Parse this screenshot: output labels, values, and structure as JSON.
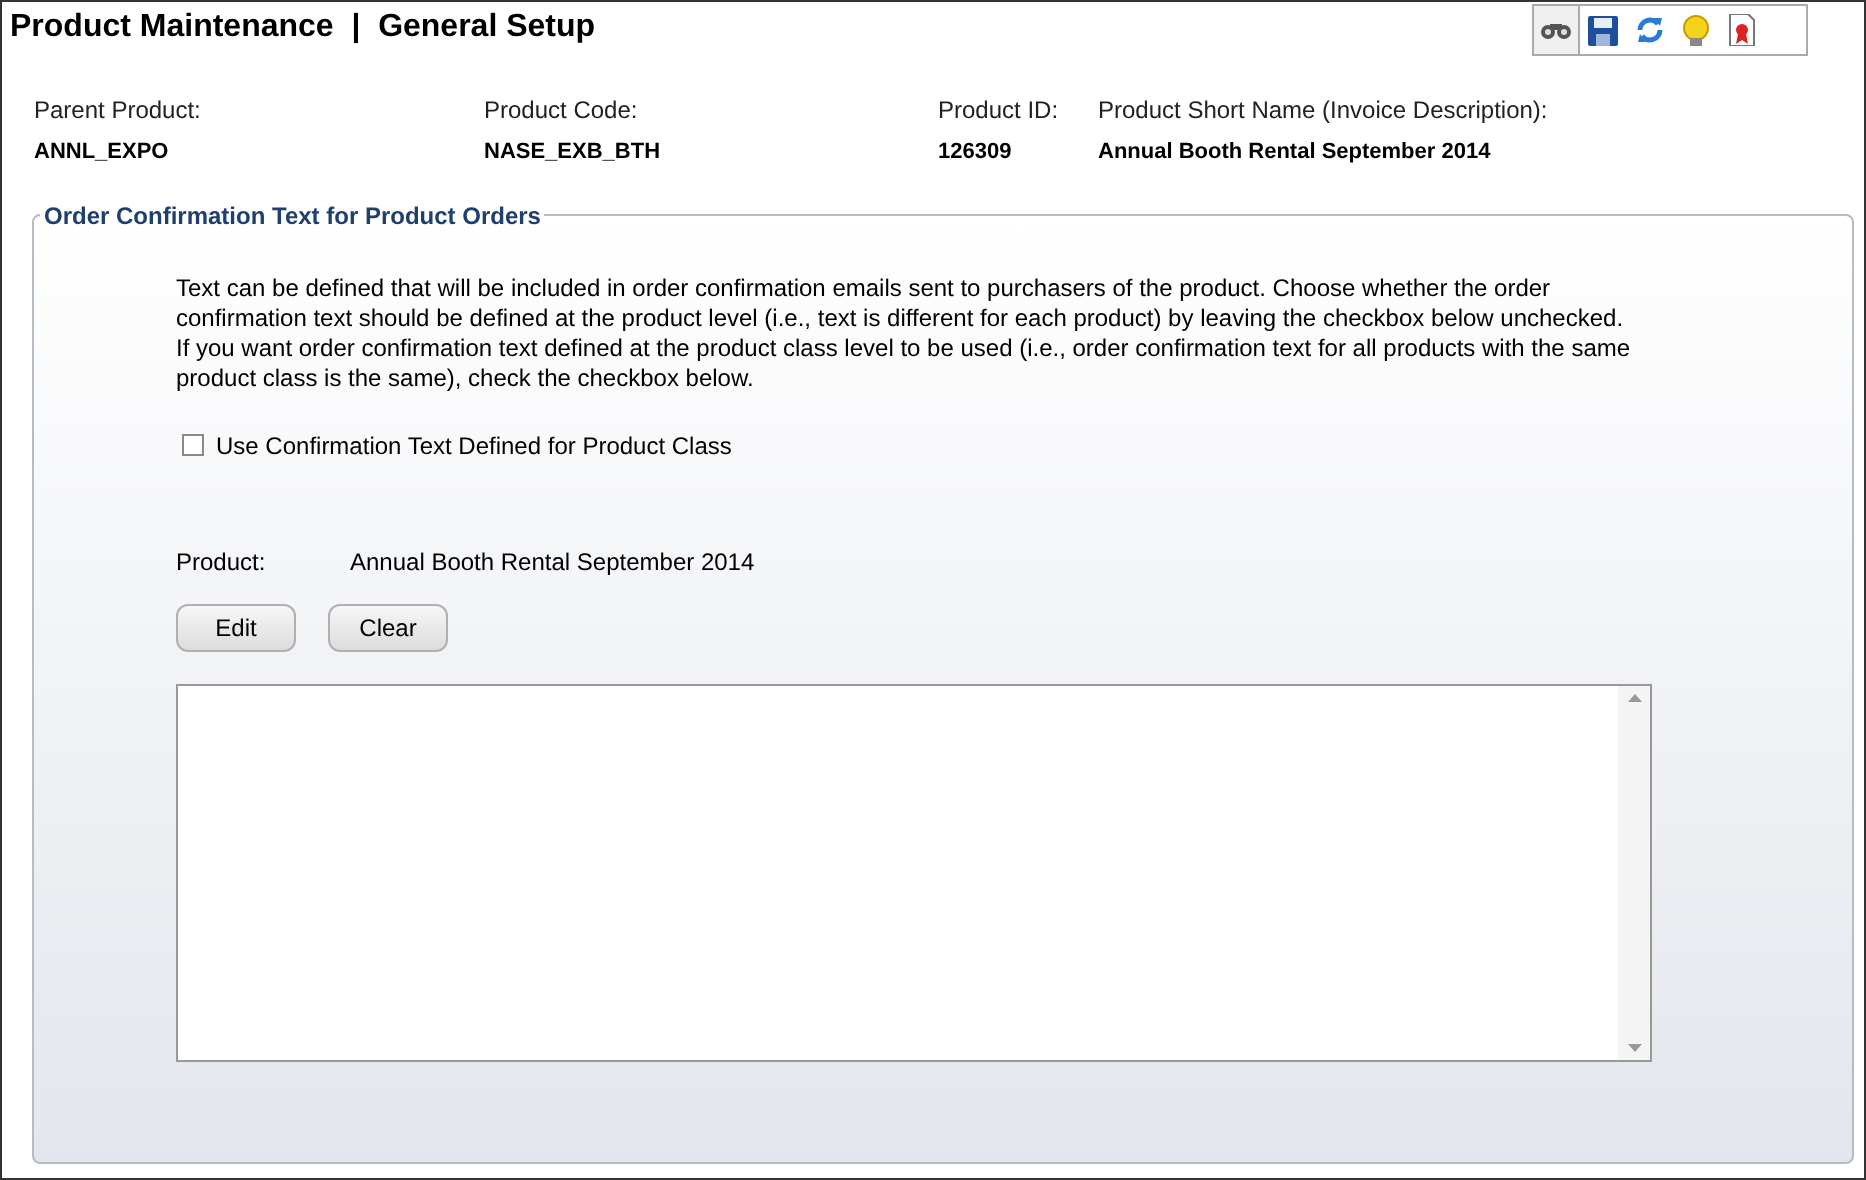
{
  "title": "Product Maintenance  |  General Setup",
  "toolbar": [
    {
      "kind": "binoculars",
      "selected": true
    },
    {
      "kind": "save",
      "selected": false
    },
    {
      "kind": "refresh",
      "selected": false
    },
    {
      "kind": "bulb",
      "selected": false
    },
    {
      "kind": "report",
      "selected": false
    }
  ],
  "fields": [
    {
      "label": "Parent Product:",
      "value": "ANNL_EXPO"
    },
    {
      "label": "Product Code:",
      "value": "NASE_EXB_BTH"
    },
    {
      "label": "Product ID:",
      "value": "126309"
    },
    {
      "label": "Product Short Name (Invoice Description):",
      "value": "Annual Booth Rental September 2014"
    }
  ],
  "section": {
    "legend": "Order Confirmation Text for Product Orders",
    "description": "Text can be defined that will be included in order confirmation emails sent to purchasers of the product. Choose whether the order confirmation text should be defined at the product level (i.e., text is different for each product) by leaving the checkbox below unchecked. If you want order confirmation text defined at the product class level to be used (i.e., order confirmation text for all products with the same product class is the same), check the checkbox below.",
    "checkbox": {
      "label": "Use Confirmation Text Defined for Product Class",
      "checked": false
    },
    "product_label": "Product:",
    "product_value": "Annual Booth Rental September 2014",
    "buttons": [
      "Edit",
      "Clear"
    ]
  }
}
